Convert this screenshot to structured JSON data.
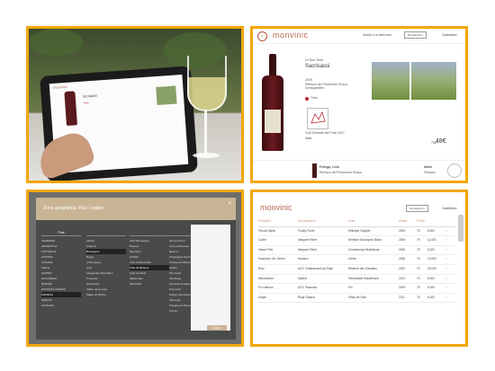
{
  "colors": {
    "frame": "#f3a60b",
    "brand": "#b46a55",
    "dialog_head": "#c9b596"
  },
  "tablet_photo": {
    "app_logo": "monvinic",
    "wine_name": "Scrisassi",
    "badge": "Tinto"
  },
  "detail": {
    "logo": "monvinic",
    "add_selection": "Añadir a la selección",
    "my_selection": "Mi selección",
    "language": "Castellano",
    "producer": "Le Due Terre",
    "wine_name": "Sacrisassi",
    "year": "2005",
    "grapes": "Refosco del Peduncolo Rosso, Schioppettino",
    "type": "Tinto",
    "region": "Colli Orientali del Friuli DOC",
    "country": "Italia",
    "bottom_name": "Fellega, Livio",
    "bottom_sub": "Refosco del Peduncolo Rosso",
    "price_size": "75cl",
    "price": "48€",
    "alt_name": "Miani",
    "alt_sub": "Friulano"
  },
  "dialog": {
    "title": "Zona geográfica: País / región",
    "close": "×",
    "apply_label": "Aceptar",
    "columns": [
      {
        "header": "País",
        "items": [
          "ALEMANIA",
          "ARGENTINA",
          "AUSTRALIA",
          "AUSTRIA",
          "CANADA",
          "CHILE",
          "CHIPRE",
          "ESLOVENIA",
          "ESPAÑA",
          "ESTADOS UNIDOS",
          "FRANCIA",
          "GRECIA",
          "HUNGRIA"
        ],
        "selected": "FRANCIA"
      },
      {
        "header": "",
        "items": [
          "Alsace",
          "Ardèche",
          "Bourgogne",
          "Bugey",
          "Champagne",
          "Jura",
          "Languedoc-Roussillon",
          "Provence",
          "Sud-Ouest",
          "Vallée de la Loire",
          "Vallée du Rhône"
        ],
        "selected": "Bourgogne"
      },
      {
        "header": "",
        "items": [
          "AOC Bourgogne",
          "Beaune",
          "Bouzeron",
          "Chablis",
          "Côte Chalonnaise",
          "Côte de Beaune",
          "Côte de Nuits",
          "Mâconnais",
          "Saint-Bris"
        ],
        "selected": "Côte de Beaune"
      },
      {
        "header": "",
        "items": [
          "Aloxe-Corton",
          "Auxey-Duresses",
          "Beaune",
          "Chassagne-Montrachet",
          "Chorey-les-Beaune",
          "Ladoix",
          "Meursault",
          "Monthelie",
          "Pernand-Vergelesses",
          "Pommard",
          "Puligny-Montrachet",
          "Santenay",
          "Savigny-les-Beaune",
          "Volnay"
        ],
        "selected": ""
      }
    ]
  },
  "table": {
    "logo": "monvinic",
    "my_selection": "Mi selección",
    "language": "Castellano",
    "headers": [
      "Productor",
      "Denominación",
      "Uvas",
      "Añada",
      "Precio",
      "",
      ""
    ],
    "rows": [
      [
        "Tenuta Santa",
        "Pouilly Fumé",
        "Willandé Viognier",
        "2005",
        "75",
        "6,000",
        ""
      ],
      [
        "Cullen",
        "Margaret River",
        "Sémillon Sauvignon Blanc",
        "2009",
        "75",
        "11,000",
        ""
      ],
      [
        "Vasse Felix",
        "Margaret River",
        "Chardonnay Heytesbury",
        "2006",
        "75",
        "6,000",
        ""
      ],
      [
        "Sanpedro Vin. Divino",
        "Navarra",
        "Lirrets",
        "2008",
        "75",
        "10,000",
        ""
      ],
      [
        "Rolo",
        "AOC Chateauneuf-du-Pape",
        "Réserve des Gardians",
        "2002",
        "75",
        "26,000",
        ""
      ],
      [
        "Macarthone",
        "Madrid",
        "Tempranillo Macarthone",
        "2012",
        "75",
        "5,000",
        ""
      ],
      [
        "Pio Ulteroni",
        "DOC Piacenza",
        "Pio",
        "2009",
        "75",
        "6,000",
        ""
      ],
      [
        "Ampel",
        "Rioja Clásica",
        "Viñas de Gain",
        "2011",
        "75",
        "8,000",
        ""
      ]
    ]
  }
}
